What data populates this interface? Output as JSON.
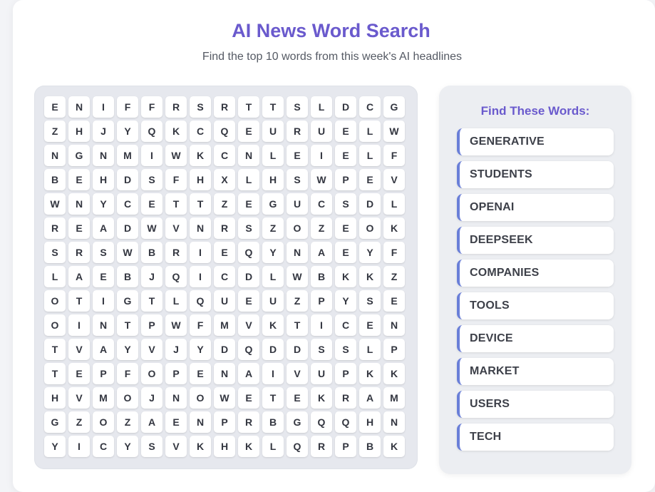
{
  "header": {
    "title": "AI News Word Search",
    "subtitle": "Find the top 10 words from this week's AI headlines"
  },
  "grid": {
    "rows": [
      [
        "E",
        "N",
        "I",
        "F",
        "F",
        "R",
        "S",
        "R",
        "T",
        "T",
        "S",
        "L",
        "D",
        "C",
        "G"
      ],
      [
        "Z",
        "H",
        "J",
        "Y",
        "Q",
        "K",
        "C",
        "Q",
        "E",
        "U",
        "R",
        "U",
        "E",
        "L",
        "W"
      ],
      [
        "N",
        "G",
        "N",
        "M",
        "I",
        "W",
        "K",
        "C",
        "N",
        "L",
        "E",
        "I",
        "E",
        "L",
        "F"
      ],
      [
        "B",
        "E",
        "H",
        "D",
        "S",
        "F",
        "H",
        "X",
        "L",
        "H",
        "S",
        "W",
        "P",
        "E",
        "V"
      ],
      [
        "W",
        "N",
        "Y",
        "C",
        "E",
        "T",
        "T",
        "Z",
        "E",
        "G",
        "U",
        "C",
        "S",
        "D",
        "L"
      ],
      [
        "R",
        "E",
        "A",
        "D",
        "W",
        "V",
        "N",
        "R",
        "S",
        "Z",
        "O",
        "Z",
        "E",
        "O",
        "K"
      ],
      [
        "S",
        "R",
        "S",
        "W",
        "B",
        "R",
        "I",
        "E",
        "Q",
        "Y",
        "N",
        "A",
        "E",
        "Y",
        "F"
      ],
      [
        "L",
        "A",
        "E",
        "B",
        "J",
        "Q",
        "I",
        "C",
        "D",
        "L",
        "W",
        "B",
        "K",
        "K",
        "Z"
      ],
      [
        "O",
        "T",
        "I",
        "G",
        "T",
        "L",
        "Q",
        "U",
        "E",
        "U",
        "Z",
        "P",
        "Y",
        "S",
        "E"
      ],
      [
        "O",
        "I",
        "N",
        "T",
        "P",
        "W",
        "F",
        "M",
        "V",
        "K",
        "T",
        "I",
        "C",
        "E",
        "N"
      ],
      [
        "T",
        "V",
        "A",
        "Y",
        "V",
        "J",
        "Y",
        "D",
        "Q",
        "D",
        "D",
        "S",
        "S",
        "L",
        "P"
      ],
      [
        "T",
        "E",
        "P",
        "F",
        "O",
        "P",
        "E",
        "N",
        "A",
        "I",
        "V",
        "U",
        "P",
        "K",
        "K"
      ],
      [
        "H",
        "V",
        "M",
        "O",
        "J",
        "N",
        "O",
        "W",
        "E",
        "T",
        "E",
        "K",
        "R",
        "A",
        "M"
      ],
      [
        "G",
        "Z",
        "O",
        "Z",
        "A",
        "E",
        "N",
        "P",
        "R",
        "B",
        "G",
        "Q",
        "Q",
        "H",
        "N"
      ],
      [
        "Y",
        "I",
        "C",
        "Y",
        "S",
        "V",
        "K",
        "H",
        "K",
        "L",
        "Q",
        "R",
        "P",
        "B",
        "K"
      ]
    ]
  },
  "sidebar": {
    "heading": "Find These Words:",
    "words": [
      "GENERATIVE",
      "STUDENTS",
      "OPENAI",
      "DEEPSEEK",
      "COMPANIES",
      "TOOLS",
      "DEVICE",
      "MARKET",
      "USERS",
      "TECH"
    ]
  }
}
